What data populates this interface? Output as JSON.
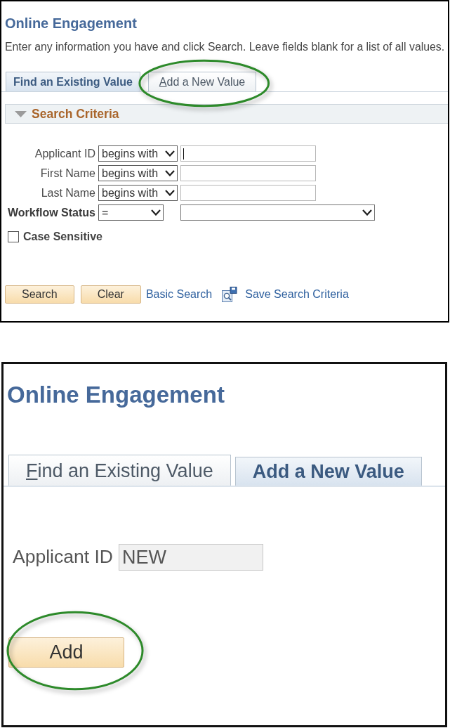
{
  "panels": [
    {
      "kind": "search",
      "title": "Online Engagement",
      "instructions": "Enter any information you have and click Search. Leave fields blank for a list of all values.",
      "tabs": [
        {
          "label": "Find an Existing Value",
          "selected": true,
          "highlighted": false
        },
        {
          "label": "Add a New Value",
          "selected": false,
          "highlighted": true
        }
      ],
      "section": {
        "title": "Search Criteria",
        "expanded": true
      },
      "criteria": [
        {
          "kind": "text",
          "label": "Applicant ID",
          "operator": "begins with",
          "focused": true
        },
        {
          "kind": "text",
          "label": "First Name",
          "operator": "begins with",
          "focused": false
        },
        {
          "kind": "text",
          "label": "Last Name",
          "operator": "begins with",
          "focused": false
        },
        {
          "kind": "select",
          "label": "Workflow Status",
          "operator": "="
        }
      ],
      "case_sensitive": {
        "label": "Case Sensitive",
        "checked": false
      },
      "actions": [
        {
          "kind": "button",
          "label": "Search"
        },
        {
          "kind": "button",
          "label": "Clear"
        },
        {
          "kind": "link",
          "label": "Basic Search"
        },
        {
          "kind": "icon-link",
          "label": "Save Search Criteria"
        }
      ]
    },
    {
      "kind": "add",
      "title": "Online Engagement",
      "tabs": [
        {
          "label": "Find an Existing Value",
          "selected": false,
          "highlighted": false
        },
        {
          "label": "Add a New Value",
          "selected": true,
          "highlighted": false
        }
      ],
      "fields": [
        {
          "label": "Applicant ID",
          "value": "NEW",
          "disabled": true
        }
      ],
      "buttons": [
        {
          "label": "Add",
          "highlighted": true
        }
      ]
    }
  ]
}
